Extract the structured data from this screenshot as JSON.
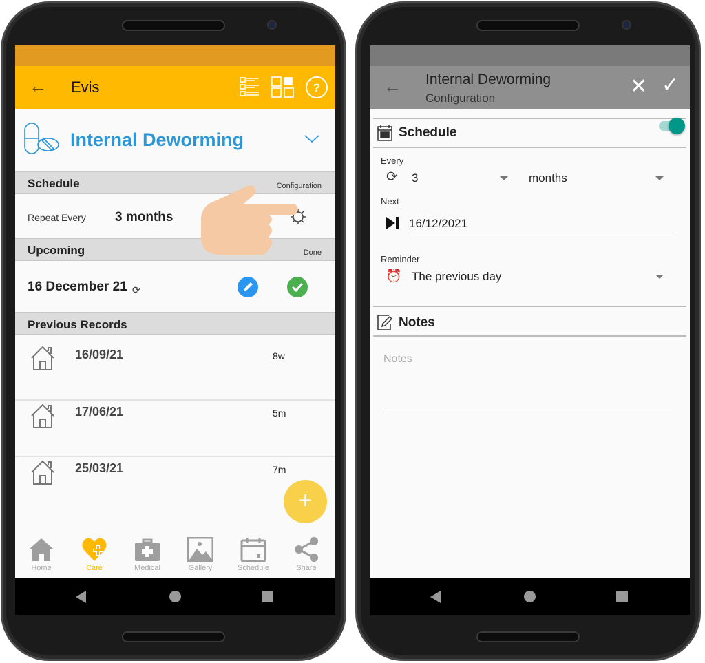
{
  "left": {
    "toolbar": {
      "title": "Evis"
    },
    "category": {
      "title": "Internal Deworming",
      "color": "#2b96d8"
    },
    "schedule": {
      "header": "Schedule",
      "action": "Configuration",
      "repeat_label": "Repeat Every",
      "repeat_value": "3 months"
    },
    "upcoming": {
      "header": "Upcoming",
      "action": "Done",
      "date": "16 December 21"
    },
    "previous": {
      "header": "Previous Records",
      "records": [
        {
          "date": "16/09/21",
          "ago": "8w"
        },
        {
          "date": "17/06/21",
          "ago": "5m"
        },
        {
          "date": "25/03/21",
          "ago": "7m"
        }
      ]
    },
    "bottom_nav": [
      {
        "label": "Home",
        "icon": "home-icon"
      },
      {
        "label": "Care",
        "icon": "heart-plus-icon",
        "active": true
      },
      {
        "label": "Medical",
        "icon": "medical-kit-icon"
      },
      {
        "label": "Gallery",
        "icon": "image-icon"
      },
      {
        "label": "Schedule",
        "icon": "calendar-icon"
      },
      {
        "label": "Share",
        "icon": "share-icon"
      }
    ],
    "colors": {
      "status": "#e39a21",
      "toolbar": "#ffb900",
      "fab": "#f8d04a",
      "accent": "#ffb900"
    }
  },
  "right": {
    "toolbar": {
      "title": "Internal Deworming",
      "subtitle": "Configuration"
    },
    "schedule": {
      "header": "Schedule",
      "enabled": true,
      "every_label": "Every",
      "every_value": "3",
      "every_unit": "months",
      "next_label": "Next",
      "next_value": "16/12/2021",
      "reminder_label": "Reminder",
      "reminder_value": "The previous day"
    },
    "notes": {
      "header": "Notes",
      "placeholder": "Notes"
    },
    "colors": {
      "status": "#7a7a7a",
      "toolbar": "#8f8f8f",
      "toggle": "#009688"
    }
  }
}
